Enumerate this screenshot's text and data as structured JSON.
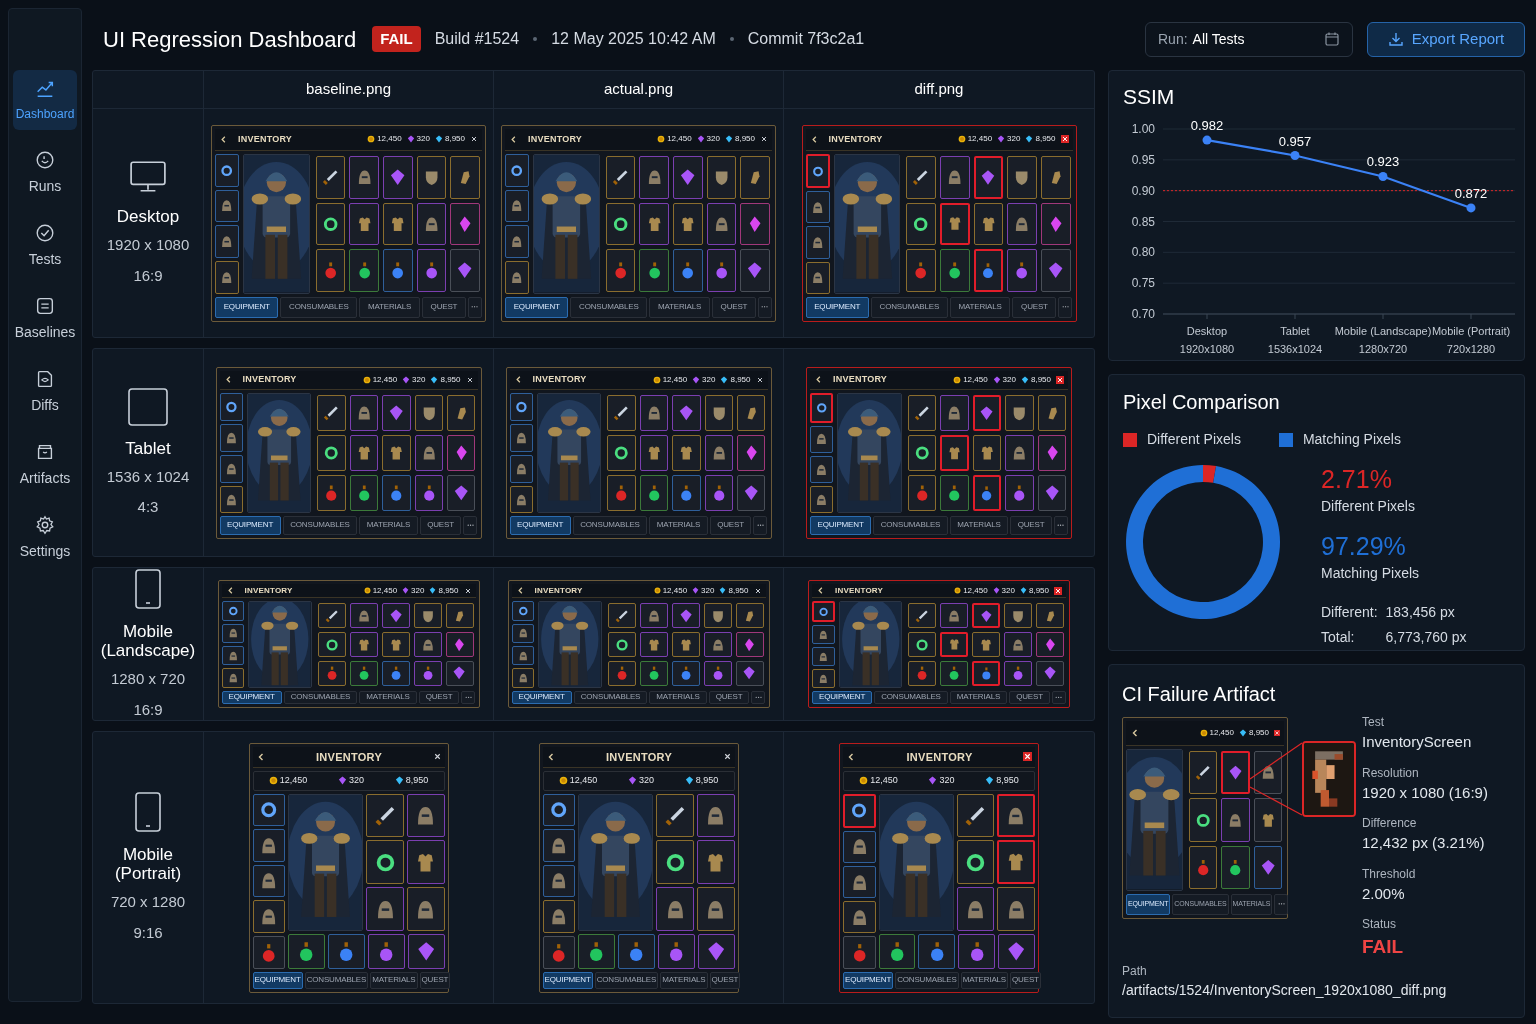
{
  "header": {
    "title": "UI Regression Dashboard",
    "status": "FAIL",
    "build": "Build #1524",
    "timestamp": "12 May 2025 10:42 AM",
    "commit": "Commit 7f3c2a1"
  },
  "run_filter": {
    "label": "Run:",
    "value": "All Tests"
  },
  "export_button": {
    "label": "Export Report"
  },
  "sidebar": {
    "items": [
      {
        "label": "Dashboard",
        "kind": "dashboard",
        "selected": true
      },
      {
        "label": "Runs",
        "kind": "runs",
        "selected": false
      },
      {
        "label": "Tests",
        "kind": "tests",
        "selected": false
      },
      {
        "label": "Baselines",
        "kind": "baselines",
        "selected": false
      },
      {
        "label": "Diffs",
        "kind": "diffs",
        "selected": false
      },
      {
        "label": "Artifacts",
        "kind": "artifacts",
        "selected": false
      },
      {
        "label": "Settings",
        "kind": "settings",
        "selected": false
      }
    ]
  },
  "comparison": {
    "columns": [
      "baseline.png",
      "actual.png",
      "diff.png"
    ],
    "rows": [
      {
        "device": {
          "kind": "desktop",
          "name": "Desktop",
          "resolution": "1920 x 1080",
          "aspect": "16:9"
        },
        "screens": [
          {
            "title": "INVENTORY",
            "currencies": [
              "12,450",
              "320",
              "8,950"
            ],
            "tabs": [
              {
                "label": "EQUIPMENT",
                "selected": true
              },
              {
                "label": "CONSUMABLES",
                "selected": false
              },
              {
                "label": "MATERIALS",
                "selected": false
              },
              {
                "label": "QUEST",
                "selected": false
              }
            ],
            "diff_marks": false
          },
          {
            "title": "INVENTORY",
            "currencies": [
              "12,450",
              "320",
              "8,950"
            ],
            "tabs": [
              {
                "label": "EQUIPMENT",
                "selected": true
              },
              {
                "label": "CONSUMABLES",
                "selected": false
              },
              {
                "label": "MATERIALS",
                "selected": false
              },
              {
                "label": "QUEST",
                "selected": false
              }
            ],
            "diff_marks": false
          },
          {
            "title": "INVENTORY",
            "currencies": [
              "12,450",
              "320",
              "8,950"
            ],
            "tabs": [
              {
                "label": "EQUIPMENT",
                "selected": true
              },
              {
                "label": "CONSUMABLES",
                "selected": false
              },
              {
                "label": "MATERIALS",
                "selected": false
              },
              {
                "label": "QUEST",
                "selected": false
              }
            ],
            "diff_marks": true
          }
        ]
      },
      {
        "device": {
          "kind": "tablet",
          "name": "Tablet",
          "resolution": "1536 x 1024",
          "aspect": "4:3"
        },
        "screens": [
          {
            "title": "INVENTORY",
            "currencies": [
              "12,450",
              "320",
              "8,950"
            ],
            "tabs": [
              {
                "label": "EQUIPMENT",
                "selected": true
              },
              {
                "label": "CONSUMABLES",
                "selected": false
              },
              {
                "label": "MATERIALS",
                "selected": false
              },
              {
                "label": "QUEST",
                "selected": false
              }
            ],
            "diff_marks": false
          },
          {
            "title": "INVENTORY",
            "currencies": [
              "12,450",
              "320",
              "8,950"
            ],
            "tabs": [
              {
                "label": "EQUIPMENT",
                "selected": true
              },
              {
                "label": "CONSUMABLES",
                "selected": false
              },
              {
                "label": "MATERIALS",
                "selected": false
              },
              {
                "label": "QUEST",
                "selected": false
              }
            ],
            "diff_marks": false
          },
          {
            "title": "INVENTORY",
            "currencies": [
              "12,450",
              "320",
              "8,950"
            ],
            "tabs": [
              {
                "label": "EQUIPMENT",
                "selected": true
              },
              {
                "label": "CONSUMABLES",
                "selected": false
              },
              {
                "label": "MATERIALS",
                "selected": false
              },
              {
                "label": "QUEST",
                "selected": false
              }
            ],
            "diff_marks": true
          }
        ]
      },
      {
        "device": {
          "kind": "phone-landscape",
          "name": "Mobile (Landscape)",
          "resolution": "1280 x 720",
          "aspect": "16:9"
        },
        "screens": [
          {
            "title": "INVENTORY",
            "currencies": [
              "12,450",
              "320",
              "8,950"
            ],
            "tabs": [
              {
                "label": "EQUIPMENT",
                "selected": true
              },
              {
                "label": "CONSUMABLES",
                "selected": false
              },
              {
                "label": "MATERIALS",
                "selected": false
              },
              {
                "label": "QUEST",
                "selected": false
              }
            ],
            "diff_marks": false
          },
          {
            "title": "INVENTORY",
            "currencies": [
              "12,450",
              "320",
              "8,950"
            ],
            "tabs": [
              {
                "label": "EQUIPMENT",
                "selected": true
              },
              {
                "label": "CONSUMABLES",
                "selected": false
              },
              {
                "label": "MATERIALS",
                "selected": false
              },
              {
                "label": "QUEST",
                "selected": false
              }
            ],
            "diff_marks": false
          },
          {
            "title": "INVENTORY",
            "currencies": [
              "12,450",
              "320",
              "8,950"
            ],
            "tabs": [
              {
                "label": "EQUIPMENT",
                "selected": true
              },
              {
                "label": "CONSUMABLES",
                "selected": false
              },
              {
                "label": "MATERIALS",
                "selected": false
              },
              {
                "label": "QUEST",
                "selected": false
              }
            ],
            "diff_marks": true
          }
        ]
      },
      {
        "device": {
          "kind": "phone-portrait",
          "name": "Mobile (Portrait)",
          "resolution": "720 x 1280",
          "aspect": "9:16"
        },
        "screens": [
          {
            "title": "INVENTORY",
            "currencies": [
              "12,450",
              "320",
              "8,950"
            ],
            "tabs": [
              {
                "label": "EQUIPMENT",
                "selected": true
              },
              {
                "label": "CONSUMABLES",
                "selected": false
              },
              {
                "label": "MATERIALS",
                "selected": false
              },
              {
                "label": "QUEST",
                "selected": false
              }
            ],
            "diff_marks": false
          },
          {
            "title": "INVENTORY",
            "currencies": [
              "12,450",
              "320",
              "8,950"
            ],
            "tabs": [
              {
                "label": "EQUIPMENT",
                "selected": true
              },
              {
                "label": "CONSUMABLES",
                "selected": false
              },
              {
                "label": "MATERIALS",
                "selected": false
              },
              {
                "label": "QUEST",
                "selected": false
              }
            ],
            "diff_marks": false
          },
          {
            "title": "INVENTORY",
            "currencies": [
              "12,450",
              "320",
              "8,950"
            ],
            "tabs": [
              {
                "label": "EQUIPMENT",
                "selected": true
              },
              {
                "label": "CONSUMABLES",
                "selected": false
              },
              {
                "label": "MATERIALS",
                "selected": false
              },
              {
                "label": "QUEST",
                "selected": false
              }
            ],
            "diff_marks": true
          }
        ]
      }
    ]
  },
  "ssim": {
    "title": "SSIM",
    "chart_data": {
      "type": "line",
      "categories": [
        "Desktop 1920x1080",
        "Tablet 1536x1024",
        "Mobile (Landscape) 1280x720",
        "Mobile (Portrait) 720x1280"
      ],
      "series": [
        {
          "color": "#3b82f6",
          "values": [
            0.982,
            0.957,
            0.923,
            0.872
          ]
        }
      ],
      "marker": "circle",
      "grid": true,
      "ylim": [
        0.7,
        1.0
      ],
      "yticks": [
        {
          "value": 0.7,
          "label": "0.70"
        },
        {
          "value": 0.75,
          "label": "0.75"
        },
        {
          "value": 0.8,
          "label": "0.80"
        },
        {
          "value": 0.85,
          "label": "0.85"
        },
        {
          "value": 0.9,
          "label": "0.90"
        },
        {
          "value": 0.95,
          "label": "0.95"
        },
        {
          "value": 1.0,
          "label": "1.00"
        }
      ],
      "value_labels": [
        "0.982",
        "0.957",
        "0.923",
        "0.872"
      ],
      "ref_lines": [
        {
          "axis": "y",
          "value": 0.9
        }
      ]
    }
  },
  "pixel_comparison": {
    "title": "Pixel Comparison",
    "legend": [
      {
        "label": "Different Pixels",
        "color": "#dc2626"
      },
      {
        "label": "Matching Pixels",
        "color": "#1f6fd6"
      }
    ],
    "chart_data": {
      "type": "donut",
      "values": [
        2.71,
        97.29
      ]
    },
    "stats": [
      {
        "value": "2.71%",
        "label": "Different Pixels"
      },
      {
        "value": "97.29%",
        "label": "Matching Pixels"
      }
    ],
    "totals": [
      {
        "label": "Different:",
        "value": "183,456 px"
      },
      {
        "label": "Total:",
        "value": "6,773,760 px"
      }
    ]
  },
  "artifact": {
    "title": "CI Failure Artifact",
    "preview": {
      "currencies": [
        "12,450",
        "8,950"
      ],
      "tabs": [
        {
          "label": "EQUIPMENT",
          "selected": true
        },
        {
          "label": "CONSUMABLES",
          "selected": false
        },
        {
          "label": "MATERIALS",
          "selected": false
        }
      ]
    },
    "fields": [
      {
        "label": "Test",
        "value": "InventoryScreen",
        "kind": "text"
      },
      {
        "label": "Resolution",
        "value": "1920 x 1080 (16:9)",
        "kind": "text"
      },
      {
        "label": "Difference",
        "value": "12,432 px (3.21%)",
        "kind": "text"
      },
      {
        "label": "Threshold",
        "value": "2.00%",
        "kind": "text"
      },
      {
        "label": "Status",
        "value": "FAIL",
        "kind": "status"
      }
    ],
    "path": {
      "label": "Path",
      "value": "/artifacts/1524/InventoryScreen_1920x1080_diff.png"
    }
  }
}
